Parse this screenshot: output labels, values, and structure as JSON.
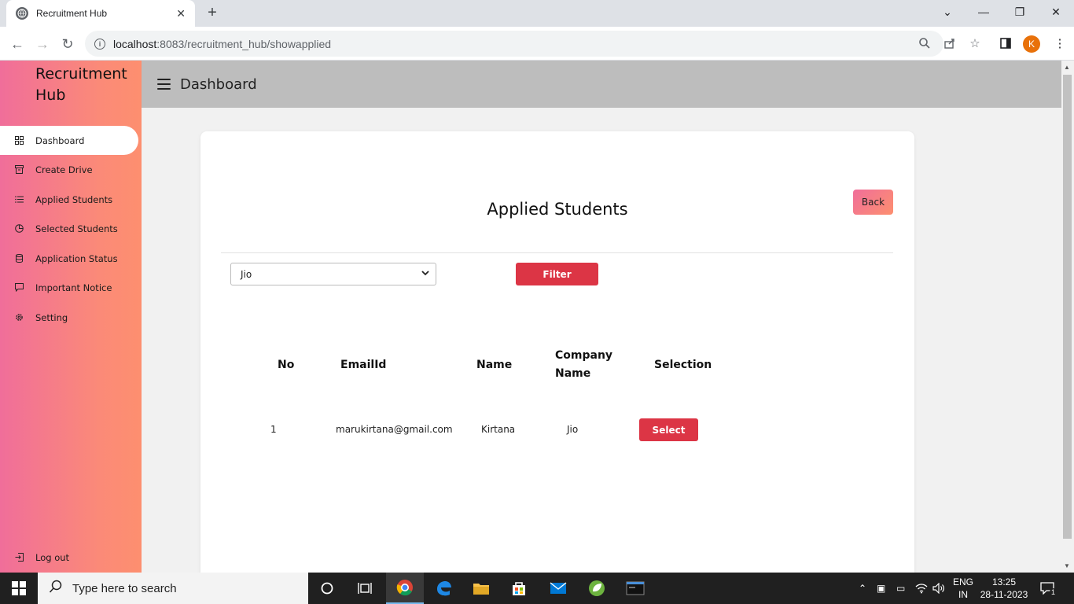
{
  "browser": {
    "tab_title": "Recruitment Hub",
    "url_host": "localhost",
    "url_rest": ":8083/recruitment_hub/showapplied",
    "profile_initial": "K"
  },
  "sidebar": {
    "brand": "Recruitment Hub",
    "items": [
      {
        "label": "Dashboard",
        "icon": "grid-icon"
      },
      {
        "label": "Create Drive",
        "icon": "archive-icon"
      },
      {
        "label": "Applied Students",
        "icon": "list-icon"
      },
      {
        "label": "Selected Students",
        "icon": "pie-chart-icon"
      },
      {
        "label": "Application Status",
        "icon": "database-icon"
      },
      {
        "label": "Important Notice",
        "icon": "message-icon"
      },
      {
        "label": "Setting",
        "icon": "gear-icon"
      }
    ],
    "logout": "Log out"
  },
  "header": {
    "title": "Dashboard"
  },
  "main": {
    "title": "Applied Students",
    "back_label": "Back",
    "company_select": "Jio",
    "filter_label": "Filter",
    "table": {
      "headers": [
        "No",
        "EmailId",
        "Name",
        "Company Name",
        "Selection"
      ],
      "rows": [
        {
          "no": "1",
          "email": "marukirtana@gmail.com",
          "name": "Kirtana",
          "company": "Jio",
          "action": "Select"
        }
      ]
    }
  },
  "taskbar": {
    "search_placeholder": "Type here to search",
    "lang_line1": "ENG",
    "lang_line2": "IN",
    "time": "13:25",
    "date": "28-11-2023",
    "notification_count": "1"
  },
  "colors": {
    "accent_red": "#dc3545",
    "sidebar_gradient_start": "#f06e9a",
    "sidebar_gradient_end": "#fd8f6f",
    "header_bg": "#bdbdbd"
  }
}
